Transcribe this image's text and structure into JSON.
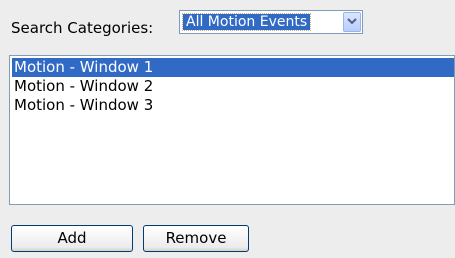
{
  "search": {
    "label": "Search Categories:",
    "selected_value": "All Motion Events"
  },
  "list": {
    "items": [
      {
        "label": "Motion - Window 1",
        "selected": true
      },
      {
        "label": "Motion - Window 2",
        "selected": false
      },
      {
        "label": "Motion - Window 3",
        "selected": false
      }
    ]
  },
  "buttons": {
    "add_label": "Add",
    "remove_label": "Remove"
  },
  "colors": {
    "selection": "#316ac5",
    "background": "#ededed",
    "border": "#7f9db9"
  }
}
